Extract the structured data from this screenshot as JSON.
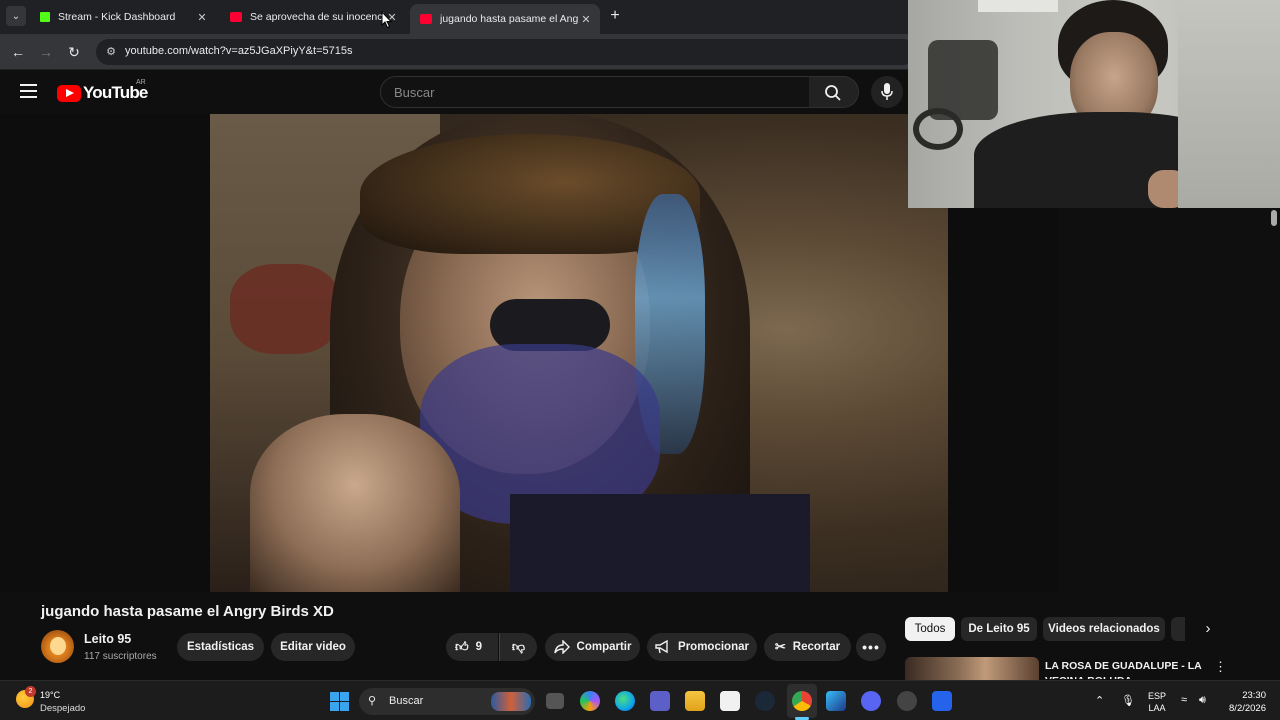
{
  "browser": {
    "tabs": [
      {
        "title": "Stream - Kick Dashboard",
        "favicon": "kick-icon"
      },
      {
        "title": "Se aprovecha de su inocencia",
        "favicon": "youtube-icon"
      },
      {
        "title": "jugando hasta pasame el Angry",
        "favicon": "youtube-icon"
      }
    ],
    "active_tab": 2,
    "url": "youtube.com/watch?v=az5JGaXPiyY&t=5715s"
  },
  "youtube": {
    "logo_text": "YouTube",
    "country_code": "AR",
    "search_placeholder": "Buscar"
  },
  "video": {
    "title": "jugando hasta pasame el Angry Birds XD",
    "channel_name": "Leito 95",
    "subscribers": "117 suscriptores",
    "like_count": "9",
    "buttons": {
      "stats": "Estadísticas",
      "edit": "Editar video",
      "share": "Compartir",
      "promote": "Promocionar",
      "clip": "Recortar"
    }
  },
  "sidebar": {
    "chips": [
      "Todos",
      "De Leito 95",
      "Videos relacionados"
    ],
    "active_chip": 0,
    "recommendation_title": "LA ROSA DE GUADALUPE - LA VECINA BOLUDA"
  },
  "taskbar": {
    "weather_temp": "19°C",
    "weather_condition": "Despejado",
    "weather_badge": "2",
    "search_label": "Buscar",
    "lang_top": "ESP",
    "lang_bottom": "LAA",
    "time": "23:30",
    "date": "8/2/2026"
  },
  "colors": {
    "youtube_red": "#ff0000",
    "kick_green": "#53fc18",
    "taskbar_accent": "#60cdff"
  }
}
